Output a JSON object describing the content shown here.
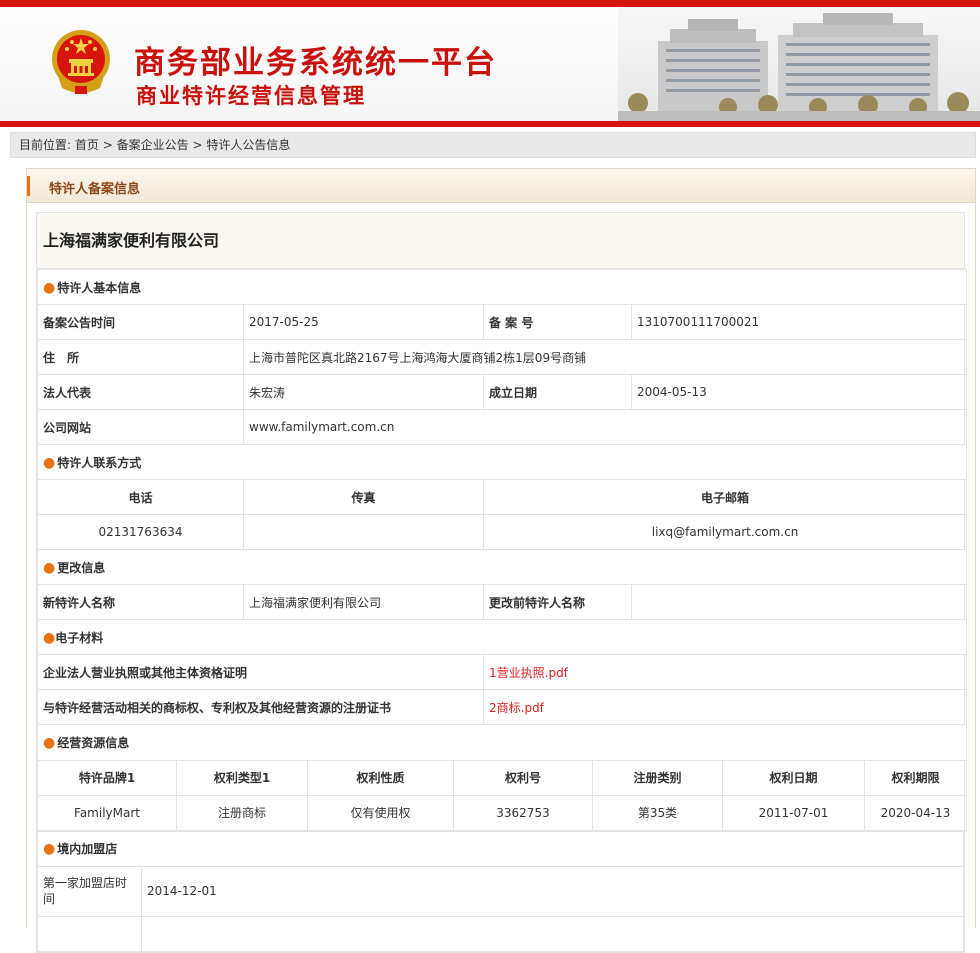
{
  "header": {
    "title": "商务部业务系统统一平台",
    "subtitle": "商业特许经营信息管理",
    "colors": {
      "brand_red": "#d6150f",
      "title_red": "#c9100b",
      "accent_orange": "#e8730b"
    },
    "icons": {
      "emblem": "national-emblem-icon",
      "building": "government-building-image"
    }
  },
  "breadcrumb": {
    "prefix": "目前位置:",
    "items": [
      "首页",
      "备案企业公告",
      "特许人公告信息"
    ],
    "separator": ">"
  },
  "panel": {
    "title": "特许人备案信息"
  },
  "company_name": "上海福满家便利有限公司",
  "basic": {
    "section": "特许人基本信息",
    "announce_date_label": "备案公告时间",
    "announce_date": "2017-05-25",
    "record_no_label": "备 案 号",
    "record_no": "1310700111700021",
    "address_label": "住　所",
    "address": "上海市普陀区真北路2167号上海鸿海大厦商铺2栋1层09号商铺",
    "legal_rep_label": "法人代表",
    "legal_rep": "朱宏涛",
    "founded_label": "成立日期",
    "founded": "2004-05-13",
    "website_label": "公司网站",
    "website": "www.familymart.com.cn"
  },
  "contact": {
    "section": "特许人联系方式",
    "headers": [
      "电话",
      "传真",
      "电子邮箱"
    ],
    "phone": "02131763634",
    "fax": "",
    "email": "lixq@familymart.com.cn"
  },
  "change": {
    "section": "更改信息",
    "new_name_label": "新特许人名称",
    "new_name": "上海福满家便利有限公司",
    "old_name_label": "更改前特许人名称",
    "old_name": ""
  },
  "materials": {
    "section": "电子材料",
    "items": [
      {
        "label": "企业法人营业执照或其他主体资格证明",
        "file": "1营业执照.pdf"
      },
      {
        "label": "与特许经营活动相关的商标权、专利权及其他经营资源的注册证书",
        "file": "2商标.pdf"
      }
    ]
  },
  "resources": {
    "section": "经营资源信息",
    "headers": [
      "特许品牌1",
      "权利类型1",
      "权利性质",
      "权利号",
      "注册类别",
      "权利日期",
      "权利期限"
    ],
    "rows": [
      [
        "FamilyMart",
        "注册商标",
        "仅有使用权",
        "3362753",
        "第35类",
        "2011-07-01",
        "2020-04-13"
      ]
    ]
  },
  "domestic": {
    "section": "境内加盟店",
    "first_store_label": "第一家加盟店时间",
    "first_store": "2014-12-01"
  }
}
